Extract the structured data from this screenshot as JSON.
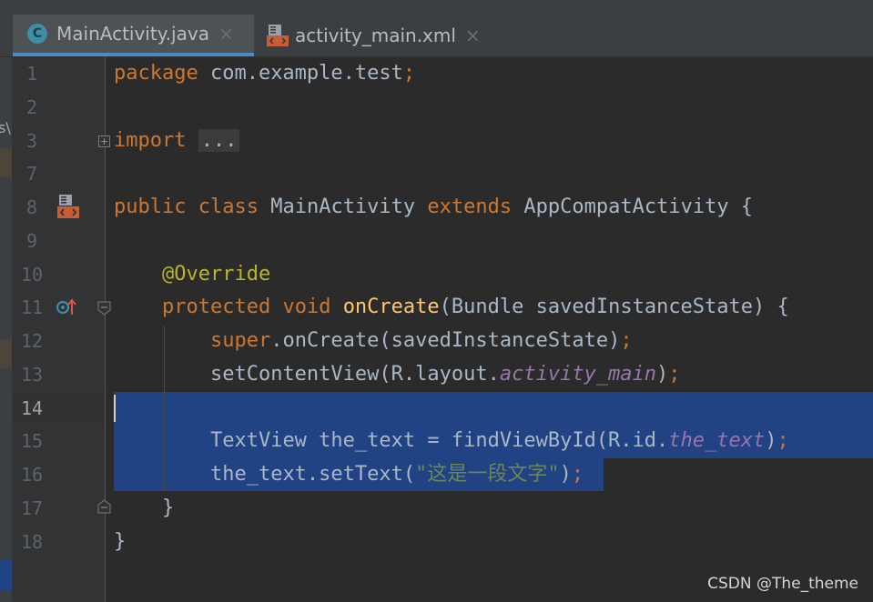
{
  "tabs": [
    {
      "label": "MainActivity.java",
      "icon": "java-class-icon",
      "active": true
    },
    {
      "label": "activity_main.xml",
      "icon": "xml-layout-icon",
      "active": false
    }
  ],
  "tab_close_glyph": "×",
  "class_icon_letter": "C",
  "left_strip_glyph": "s\\",
  "line_numbers": [
    "1",
    "2",
    "3",
    "7",
    "8",
    "9",
    "10",
    "11",
    "12",
    "13",
    "14",
    "15",
    "16",
    "17",
    "18"
  ],
  "current_line": "14",
  "code": {
    "l1": {
      "kw": "package",
      "rest": " com.example.test",
      "semi": ";"
    },
    "l3": {
      "kw": "import",
      "fold": "..."
    },
    "l8": {
      "kw1": "public",
      "kw2": "class",
      "name": "MainActivity",
      "kw3": "extends",
      "parent": "AppCompatActivity {"
    },
    "l10": {
      "ann": "@Override"
    },
    "l11": {
      "kw1": "protected",
      "kw2": "void",
      "method": "onCreate",
      "rest": "(Bundle savedInstanceState) {"
    },
    "l12": {
      "kw": "super",
      "rest": ".onCreate(savedInstanceState)",
      "semi": ";"
    },
    "l13": {
      "call": "setContentView(R.layout.",
      "field": "activity_main",
      "close": ")",
      "semi": ";"
    },
    "l15": {
      "decl": "TextView the_text = findViewById(R.id.",
      "field": "the_text",
      "close": ")",
      "semi": ";"
    },
    "l16": {
      "call": "the_text.setText(",
      "str": "\"这是一段文字\"",
      "close": ")",
      "semi": ";"
    },
    "l17": {
      "text": "}"
    },
    "l18": {
      "text": "}"
    }
  },
  "colors": {
    "keyword": "#cc7832",
    "annotation": "#bbb529",
    "method": "#ffc66d",
    "field": "#9876aa",
    "string": "#6a8759",
    "selection": "#214283"
  },
  "watermark": "CSDN @The_theme"
}
